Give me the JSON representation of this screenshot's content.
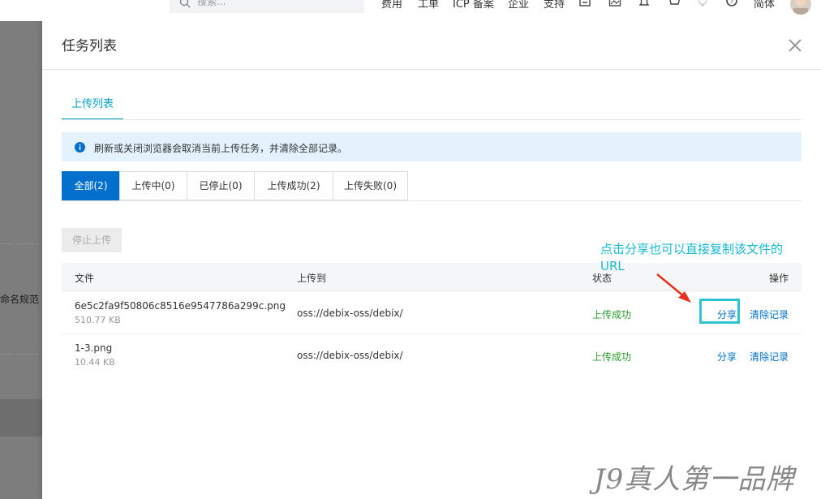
{
  "header": {
    "search_placeholder": "搜索...",
    "nav": [
      "费用",
      "工单",
      "ICP 备案",
      "企业",
      "支持"
    ],
    "lang": "简体",
    "icons": [
      "search-icon",
      "cloud-shell-icon",
      "image-icon",
      "bell-icon",
      "cart-icon",
      "bulb-icon",
      "help-icon",
      "avatar"
    ]
  },
  "background": {
    "partial_label": "命名规范"
  },
  "drawer": {
    "title": "任务列表",
    "main_tab": "上传列表",
    "notice": "刷新或关闭浏览器会取消当前上传任务，并清除全部记录。",
    "filters": [
      {
        "label": "全部(2)",
        "active": true
      },
      {
        "label": "上传中(0)",
        "active": false
      },
      {
        "label": "已停止(0)",
        "active": false
      },
      {
        "label": "上传成功(2)",
        "active": false
      },
      {
        "label": "上传失败(0)",
        "active": false
      }
    ],
    "stop_button": "停止上传",
    "table": {
      "columns": [
        "文件",
        "上传到",
        "状态",
        "操作"
      ],
      "rows": [
        {
          "name": "6e5c2fa9f50806c8516e9547786a299c.png",
          "size": "510.77 KB",
          "dest": "oss://debix-oss/debix/",
          "status": "上传成功",
          "share": "分享",
          "clear": "清除记录"
        },
        {
          "name": "1-3.png",
          "size": "10.44 KB",
          "dest": "oss://debix-oss/debix/",
          "status": "上传成功",
          "share": "分享",
          "clear": "清除记录"
        }
      ]
    }
  },
  "annotation": "点击分享也可以直接复制该文件的URL",
  "watermark": "J9真人第一品牌",
  "colors": {
    "primary": "#0070cc",
    "accent": "#00a2ca",
    "success": "#2d9d2d",
    "annotation": "#19b9d1",
    "arrow": "#e8321e",
    "notice_bg": "#e3f2fd"
  }
}
